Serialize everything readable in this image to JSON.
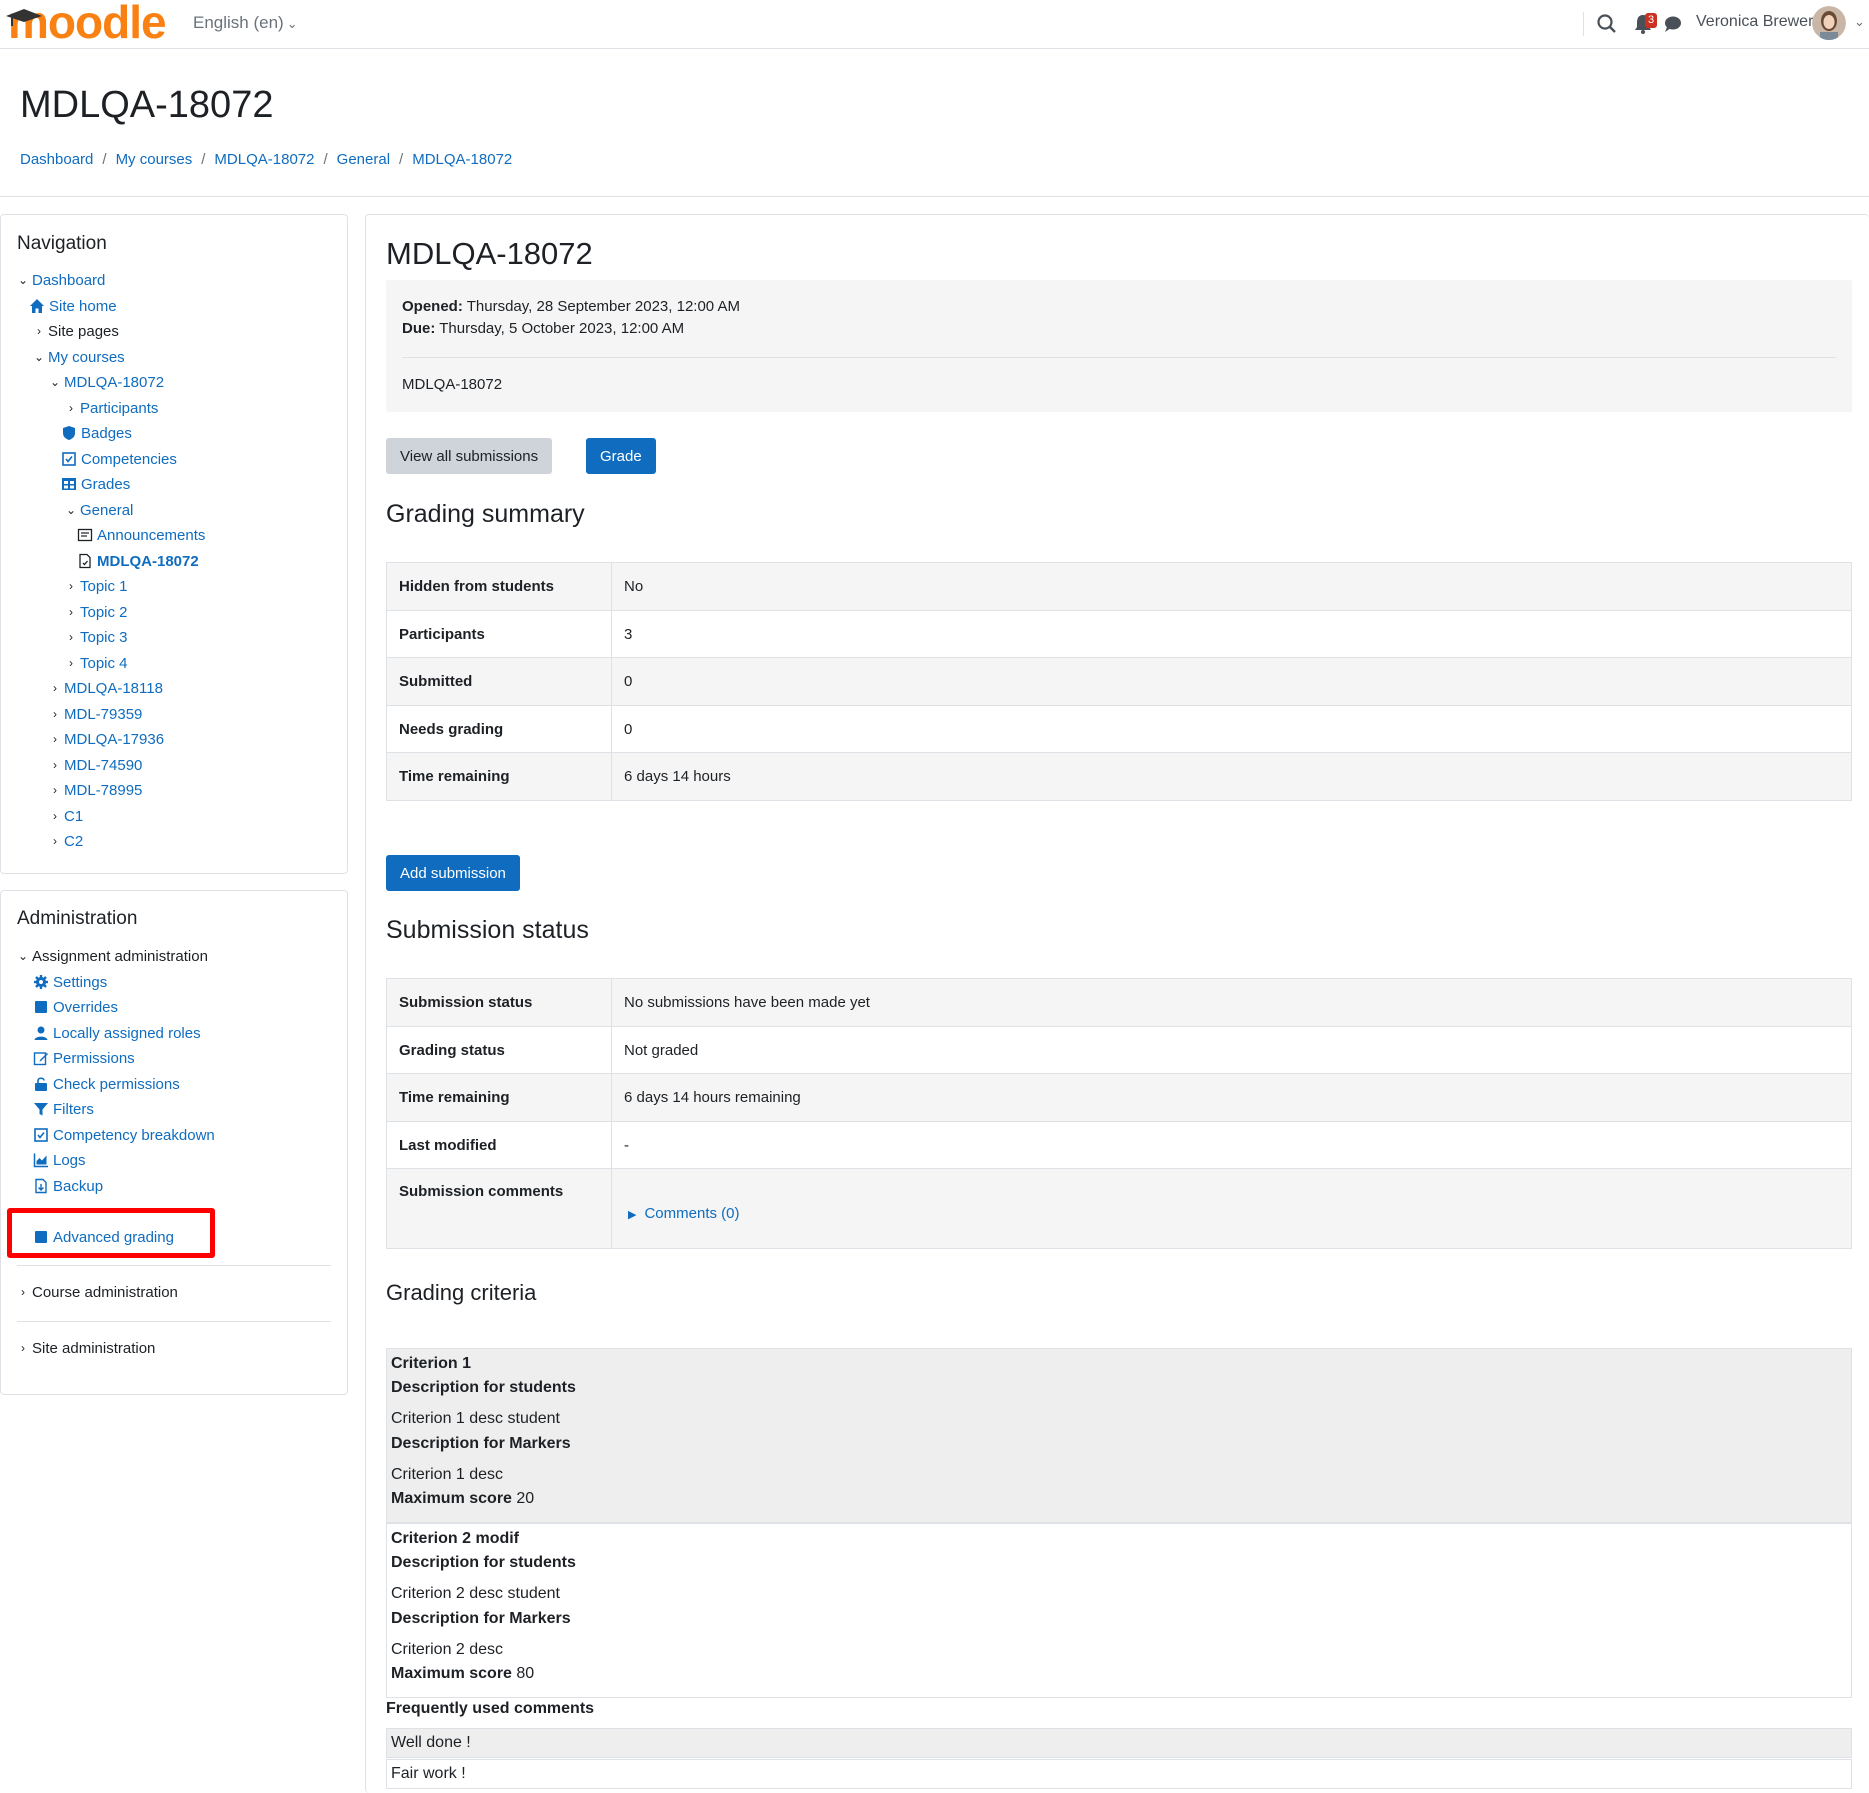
{
  "navbar": {
    "logo_text": "moodle",
    "language": "English (en)",
    "notification_count": "3",
    "user_name": "Veronica Brewer",
    "icons": [
      "search-icon",
      "bell-icon",
      "chat-icon"
    ]
  },
  "page": {
    "title": "MDLQA-18072",
    "breadcrumb": [
      "Dashboard",
      "My courses",
      "MDLQA-18072",
      "General",
      "MDLQA-18072"
    ]
  },
  "navigation": {
    "title": "Navigation",
    "items": [
      {
        "label": "Dashboard",
        "icon": "chevron-down-icon"
      },
      {
        "label": "Site home",
        "icon": "home-icon"
      },
      {
        "label": "Site pages",
        "icon": "chevron-right-icon"
      },
      {
        "label": "My courses",
        "icon": "chevron-down-icon"
      },
      {
        "label": "MDLQA-18072",
        "icon": "chevron-down-icon"
      },
      {
        "label": "Participants",
        "icon": "chevron-right-icon"
      },
      {
        "label": "Badges",
        "icon": "shield-icon"
      },
      {
        "label": "Competencies",
        "icon": "checkbox-icon"
      },
      {
        "label": "Grades",
        "icon": "table-icon"
      },
      {
        "label": "General",
        "icon": "chevron-down-icon"
      },
      {
        "label": "Announcements",
        "icon": "forum-icon"
      },
      {
        "label": "MDLQA-18072",
        "icon": "assignment-icon"
      },
      {
        "label": "Topic 1",
        "icon": "chevron-right-icon"
      },
      {
        "label": "Topic 2",
        "icon": "chevron-right-icon"
      },
      {
        "label": "Topic 3",
        "icon": "chevron-right-icon"
      },
      {
        "label": "Topic 4",
        "icon": "chevron-right-icon"
      },
      {
        "label": "MDLQA-18118",
        "icon": "chevron-right-icon"
      },
      {
        "label": "MDL-79359",
        "icon": "chevron-right-icon"
      },
      {
        "label": "MDLQA-17936",
        "icon": "chevron-right-icon"
      },
      {
        "label": "MDL-74590",
        "icon": "chevron-right-icon"
      },
      {
        "label": "MDL-78995",
        "icon": "chevron-right-icon"
      },
      {
        "label": "C1",
        "icon": "chevron-right-icon"
      },
      {
        "label": "C2",
        "icon": "chevron-right-icon"
      }
    ]
  },
  "administration": {
    "title": "Administration",
    "assignment_admin": "Assignment administration",
    "items": [
      {
        "label": "Settings",
        "icon": "gear-icon"
      },
      {
        "label": "Overrides",
        "icon": "square-icon"
      },
      {
        "label": "Locally assigned roles",
        "icon": "user-icon"
      },
      {
        "label": "Permissions",
        "icon": "edit-icon"
      },
      {
        "label": "Check permissions",
        "icon": "unlock-icon"
      },
      {
        "label": "Filters",
        "icon": "filter-icon"
      },
      {
        "label": "Competency breakdown",
        "icon": "checkbox-icon"
      },
      {
        "label": "Logs",
        "icon": "chart-icon"
      },
      {
        "label": "Backup",
        "icon": "file-icon"
      },
      {
        "label": "Advanced grading",
        "icon": "square-icon"
      }
    ],
    "course_admin": "Course administration",
    "site_admin": "Site administration"
  },
  "assignment": {
    "title": "MDLQA-18072",
    "opened_label": "Opened:",
    "opened_value": "Thursday, 28 September 2023, 12:00 AM",
    "due_label": "Due:",
    "due_value": "Thursday, 5 October 2023, 12:00 AM",
    "description": "MDLQA-18072",
    "view_all_button": "View all submissions",
    "grade_button": "Grade"
  },
  "grading_summary": {
    "title": "Grading summary",
    "rows": [
      {
        "label": "Hidden from students",
        "value": "No"
      },
      {
        "label": "Participants",
        "value": "3"
      },
      {
        "label": "Submitted",
        "value": "0"
      },
      {
        "label": "Needs grading",
        "value": "0"
      },
      {
        "label": "Time remaining",
        "value": "6 days 14 hours"
      }
    ]
  },
  "add_submission_button": "Add submission",
  "submission_status": {
    "title": "Submission status",
    "rows": [
      {
        "label": "Submission status",
        "value": "No submissions have been made yet"
      },
      {
        "label": "Grading status",
        "value": "Not graded"
      },
      {
        "label": "Time remaining",
        "value": "6 days 14 hours remaining"
      },
      {
        "label": "Last modified",
        "value": "-"
      },
      {
        "label": "Submission comments",
        "value": "Comments (0)"
      }
    ]
  },
  "grading_criteria": {
    "title": "Grading criteria",
    "criteria": [
      {
        "name": "Criterion 1",
        "students_label": "Description for students",
        "students_desc": "Criterion 1 desc student",
        "markers_label": "Description for Markers",
        "markers_desc": "Criterion 1 desc",
        "max_label": "Maximum score",
        "max_value": "20"
      },
      {
        "name": "Criterion 2 modif",
        "students_label": "Description for students",
        "students_desc": "Criterion 2 desc student",
        "markers_label": "Description for Markers",
        "markers_desc": "Criterion 2 desc",
        "max_label": "Maximum score",
        "max_value": "80"
      }
    ],
    "frequent_title": "Frequently used comments",
    "frequent": [
      "Well done !",
      "Fair work !"
    ]
  },
  "colors": {
    "link": "#0f6cbf",
    "primary_button": "#0f6cbf",
    "secondary_button": "#ced4da",
    "highlight_box": "#ff0000",
    "badge": "#ca3120"
  }
}
